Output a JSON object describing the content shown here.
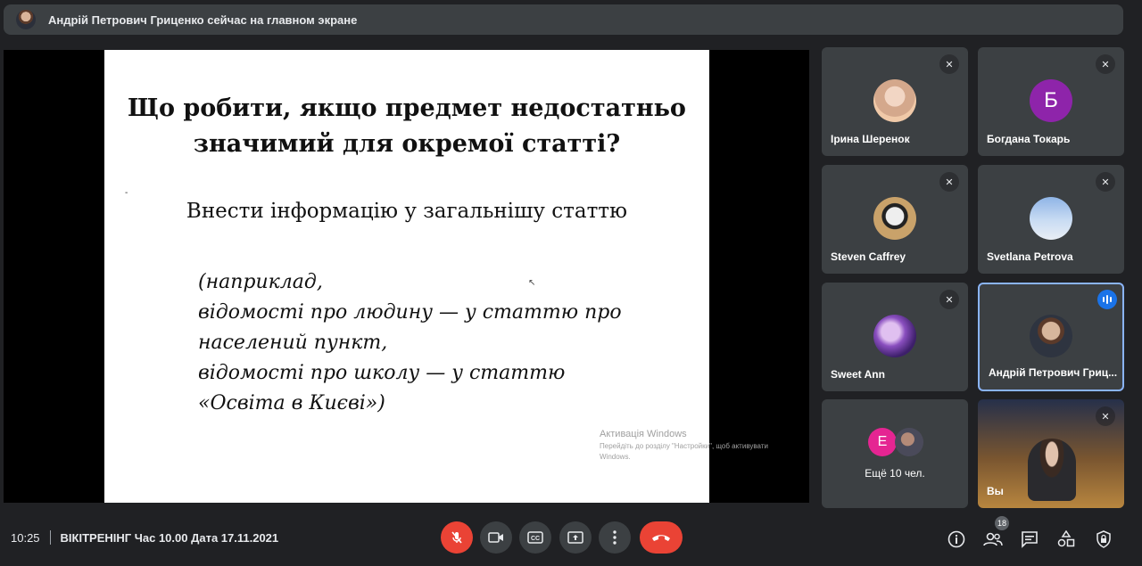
{
  "banner": {
    "presenting_text": "Андрій Петрович Гриценко сейчас на главном экране"
  },
  "slide": {
    "title_line1": "Що робити, якщо предмет недостатньо",
    "title_line2": "значимий для окремої статті?",
    "subtitle": "Внести інформацію у загальнішу статтю",
    "example_lines": [
      "(наприклад,",
      "відомості про людину — у статтю про",
      "населений пункт,",
      "відомості про школу — у статтю",
      "«Освіта в Києві»)"
    ],
    "watermark_title": "Активація Windows",
    "watermark_text": "Перейдіть до розділу \"Настройки\", щоб активувати Windows."
  },
  "participants": [
    {
      "name": "Ірина Шеренок",
      "muted": true,
      "avatar": "photo"
    },
    {
      "name": "Богдана Токарь",
      "muted": true,
      "avatar": "letter",
      "letter": "Б",
      "color": "#8e24aa"
    },
    {
      "name": "Steven Caffrey",
      "muted": true,
      "avatar": "photo"
    },
    {
      "name": "Svetlana Petrova",
      "muted": true,
      "avatar": "photo"
    },
    {
      "name": "Sweet Ann",
      "muted": true,
      "avatar": "photo"
    },
    {
      "name": "Андрій Петрович Гриценко",
      "name_display": "Андрій Петрович Гриц...",
      "speaking": true,
      "avatar": "photo"
    }
  ],
  "others_tile": {
    "letter": "E",
    "label": "Ещё 10 чел."
  },
  "self_tile": {
    "label": "Вы",
    "muted": true
  },
  "bottom": {
    "time": "10:25",
    "meeting_title": "ВІКІТРЕНІНГ Час 10.00 Дата 17.11.2021",
    "people_count": "18"
  },
  "colors": {
    "accent": "#8ab4f8",
    "danger": "#ea4335",
    "speaking": "#1a73e8"
  }
}
